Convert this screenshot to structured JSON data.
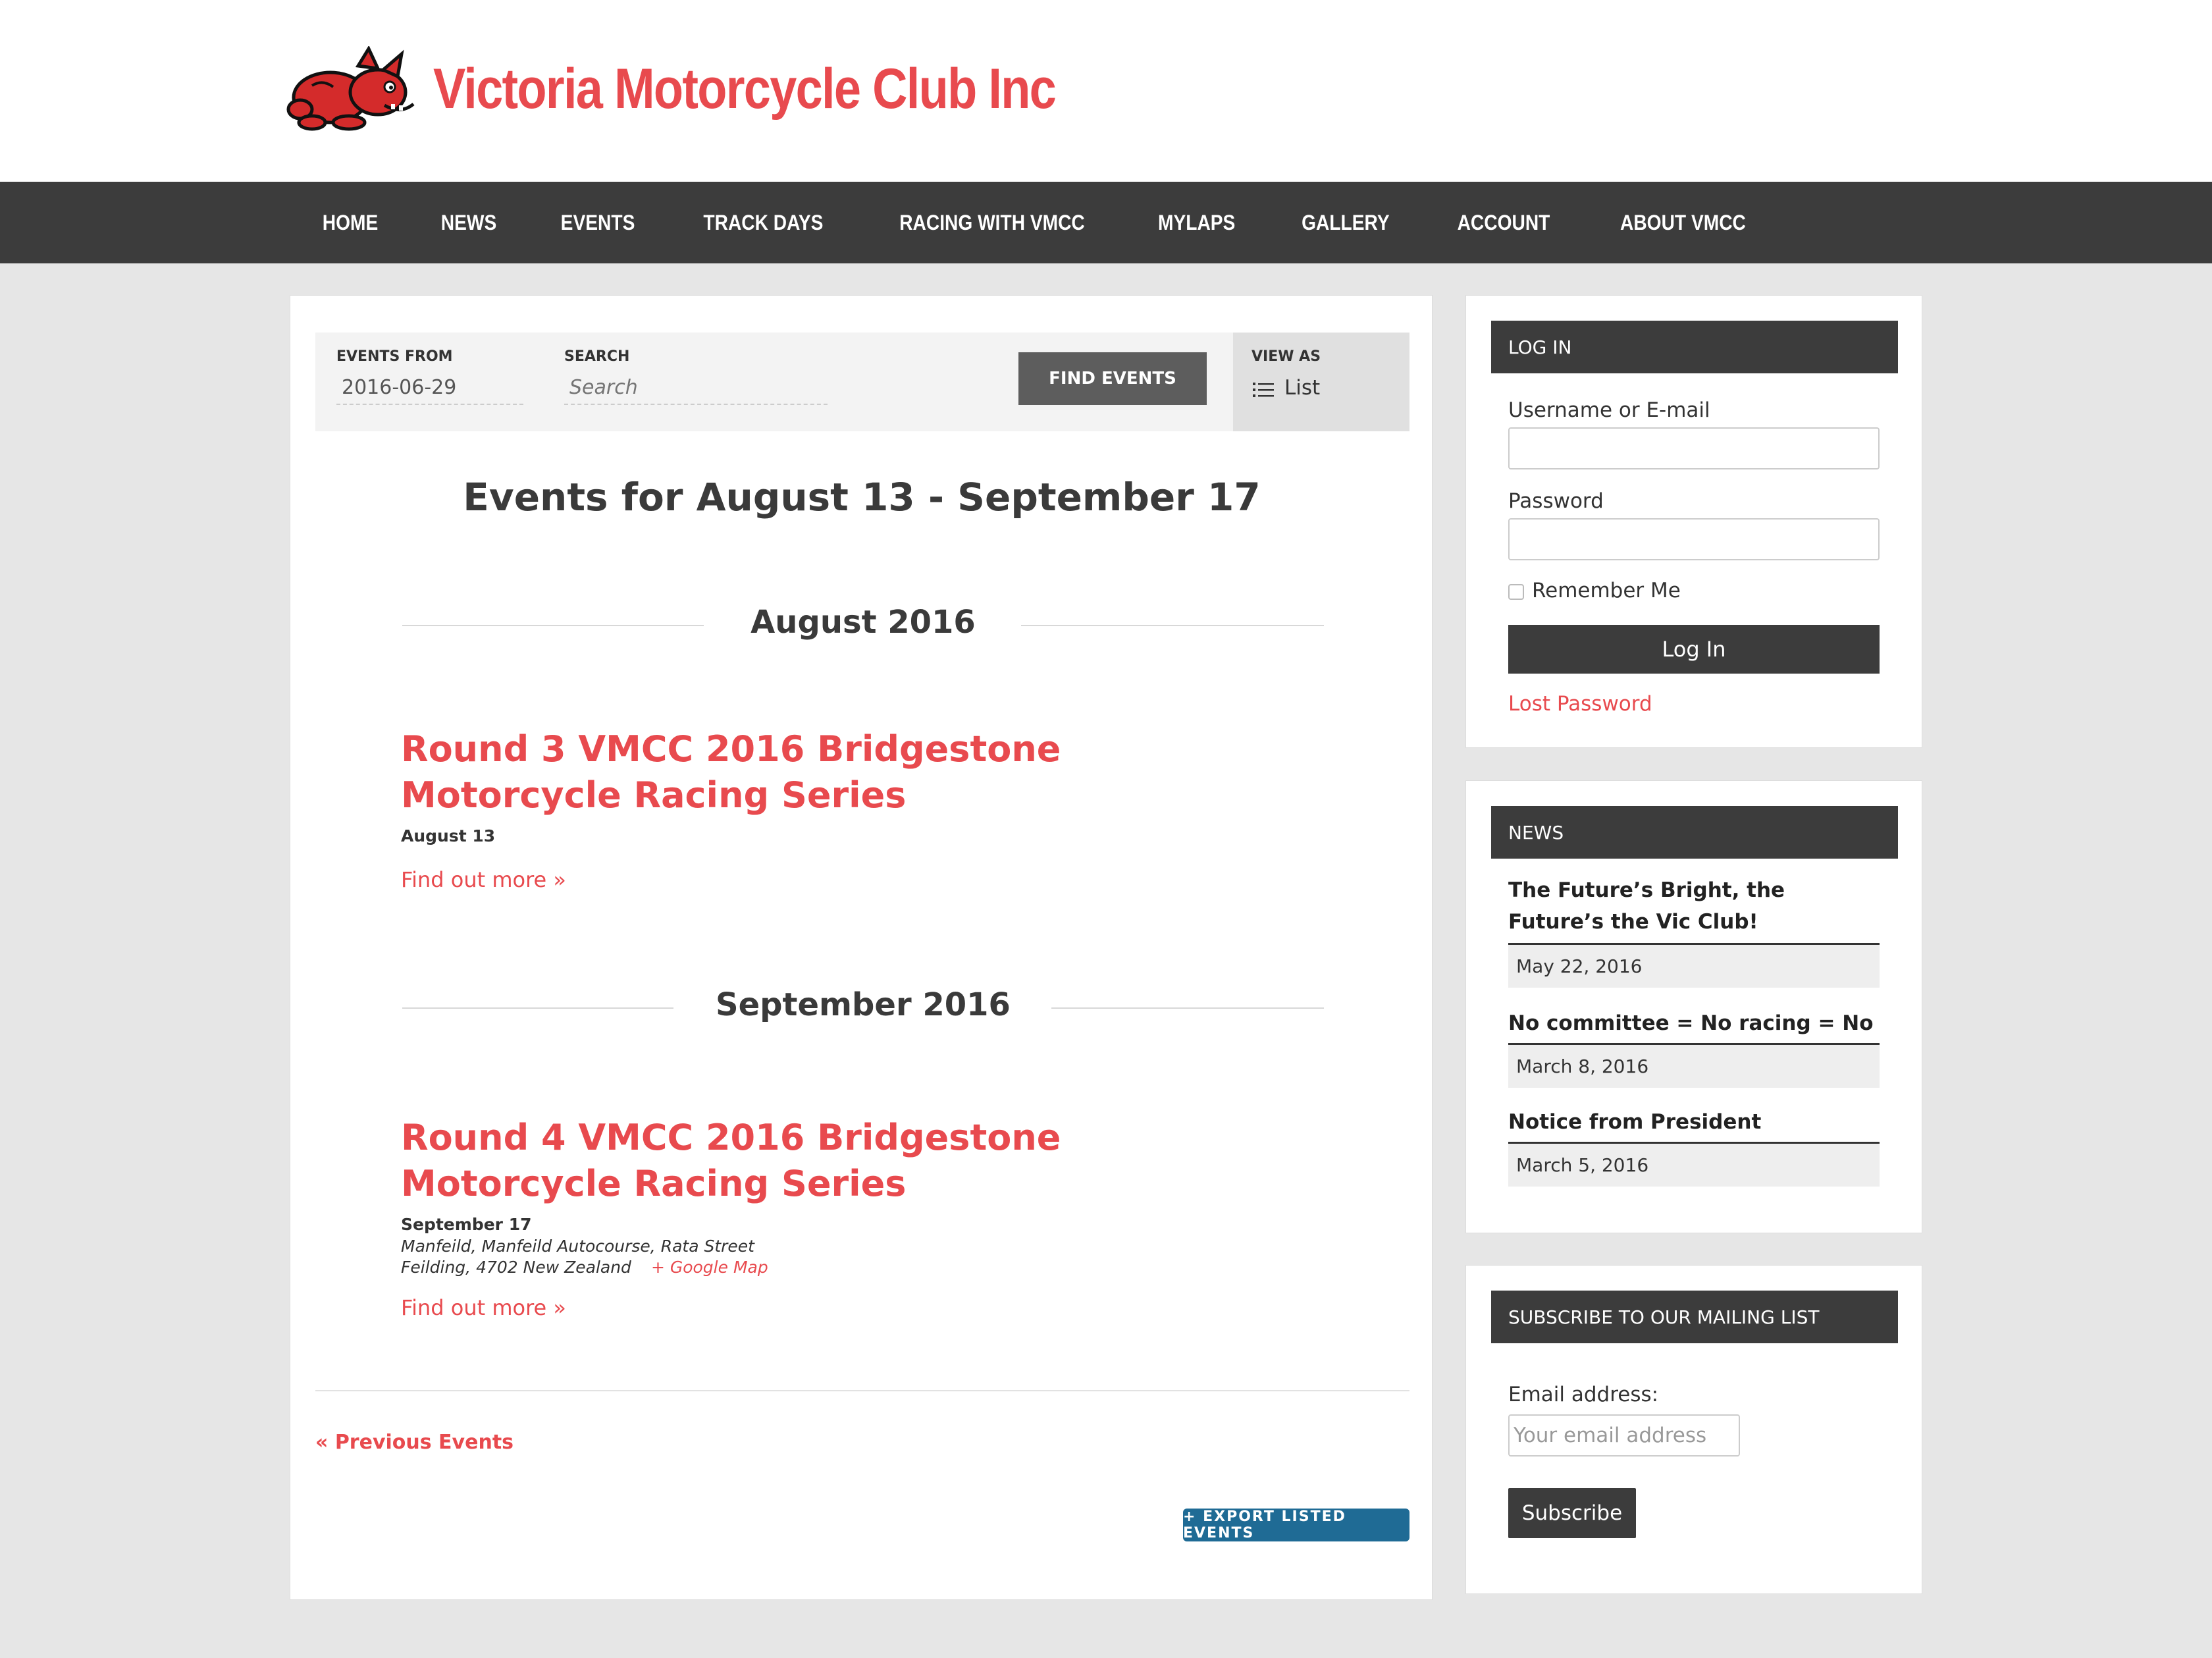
{
  "site": {
    "title": "Victoria Motorcycle Club Inc"
  },
  "nav": [
    "HOME",
    "NEWS",
    "EVENTS",
    "TRACK DAYS",
    "RACING WITH VMCC",
    "MYLAPS",
    "GALLERY",
    "ACCOUNT",
    "ABOUT VMCC"
  ],
  "filters": {
    "events_from_label": "EVENTS FROM",
    "events_from_value": "2016-06-29",
    "search_label": "SEARCH",
    "search_placeholder": "Search",
    "find_button": "FIND EVENTS",
    "view_as_label": "VIEW AS",
    "view_as_value": "List"
  },
  "events_heading": "Events for August 13 - September 17",
  "months": [
    {
      "label": "August 2016",
      "event": {
        "title": "Round 3 VMCC 2016 Bridgestone Motorcycle Racing Series",
        "date": "August 13",
        "find_more": "Find out more »"
      }
    },
    {
      "label": "September 2016",
      "event": {
        "title": "Round 4 VMCC 2016 Bridgestone Motorcycle Racing Series",
        "date": "September 17",
        "venue_line1": "Manfeild, Manfeild Autocourse, Rata Street",
        "venue_line2": "Feilding, 4702 New Zealand",
        "map_link": "+ Google Map",
        "find_more": "Find out more »"
      }
    }
  ],
  "prev_events": "« Previous Events",
  "export_button": "+ EXPORT LISTED EVENTS",
  "login": {
    "title": "LOG IN",
    "username_label": "Username or E-mail",
    "password_label": "Password",
    "remember_label": "Remember Me",
    "button": "Log In",
    "lost_password": "Lost Password"
  },
  "news": {
    "title": "NEWS",
    "items": [
      {
        "title": "The Future’s Bright, the Future’s the Vic Club!",
        "date": "May 22, 2016"
      },
      {
        "title": "No committee = No racing = No club",
        "date": "March 8, 2016"
      },
      {
        "title": "Notice from President",
        "date": "March 5, 2016"
      }
    ]
  },
  "mailing": {
    "title": "SUBSCRIBE TO OUR MAILING LIST",
    "email_label": "Email address:",
    "email_placeholder": "Your email address",
    "button": "Subscribe"
  }
}
